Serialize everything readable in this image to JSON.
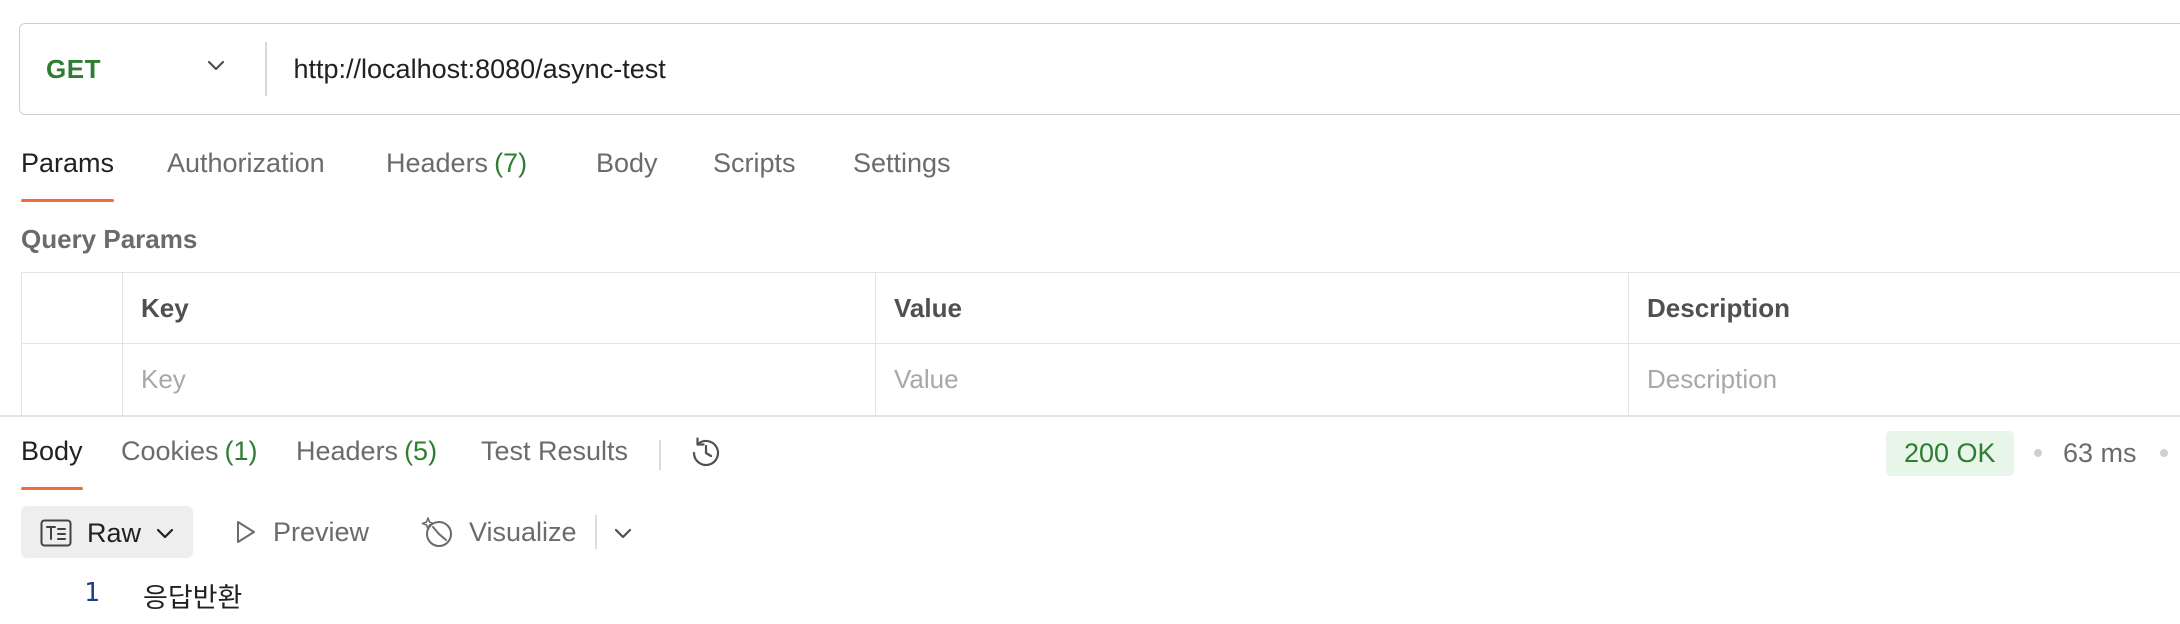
{
  "request": {
    "method": "GET",
    "url": "http://localhost:8080/async-test"
  },
  "request_tabs": [
    {
      "label": "Params",
      "active": true
    },
    {
      "label": "Authorization"
    },
    {
      "label": "Headers",
      "count": "(7)"
    },
    {
      "label": "Body"
    },
    {
      "label": "Scripts"
    },
    {
      "label": "Settings"
    }
  ],
  "query_params": {
    "title": "Query Params",
    "columns": [
      "Key",
      "Value",
      "Description"
    ],
    "placeholders": [
      "Key",
      "Value",
      "Description"
    ]
  },
  "response_tabs": [
    {
      "label": "Body",
      "active": true
    },
    {
      "label": "Cookies",
      "count": "(1)"
    },
    {
      "label": "Headers",
      "count": "(5)"
    },
    {
      "label": "Test Results"
    }
  ],
  "response_status": {
    "status": "200 OK",
    "time": "63 ms"
  },
  "body_toolbar": {
    "format": "Raw",
    "preview": "Preview",
    "visualize": "Visualize"
  },
  "response_body": {
    "lines": [
      {
        "number": "1",
        "text": "응답반환"
      }
    ]
  },
  "colors": {
    "method_green": "#2e7d32",
    "tab_accent": "#ef6c3a",
    "status_bg": "#e8f5e9"
  },
  "icons": [
    "chevron-down-icon",
    "history-icon",
    "raw-format-icon",
    "play-icon",
    "visualize-icon"
  ]
}
